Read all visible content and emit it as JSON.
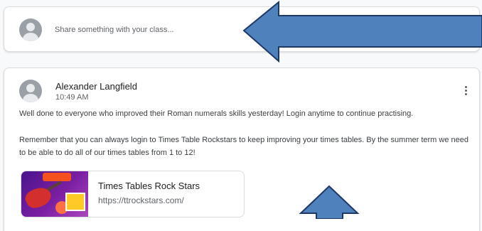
{
  "share_box": {
    "placeholder": "Share something with your class..."
  },
  "post": {
    "author": "Alexander Langfield",
    "time": "10:49 AM",
    "paragraphs": [
      "Well done to everyone who improved their Roman numerals skills yesterday! Login anytime to continue practising.",
      "Remember that you can always login to Times Table Rockstars to keep improving your times tables. By the summer term we need to be able to do all of our times tables from 1 to 12!"
    ],
    "attachment": {
      "title": "Times Tables Rock Stars",
      "url": "https://ttrockstars.com/"
    }
  },
  "annotations": {
    "arrow_color": "#4f81bd",
    "arrow_outline": "#1f3864"
  }
}
